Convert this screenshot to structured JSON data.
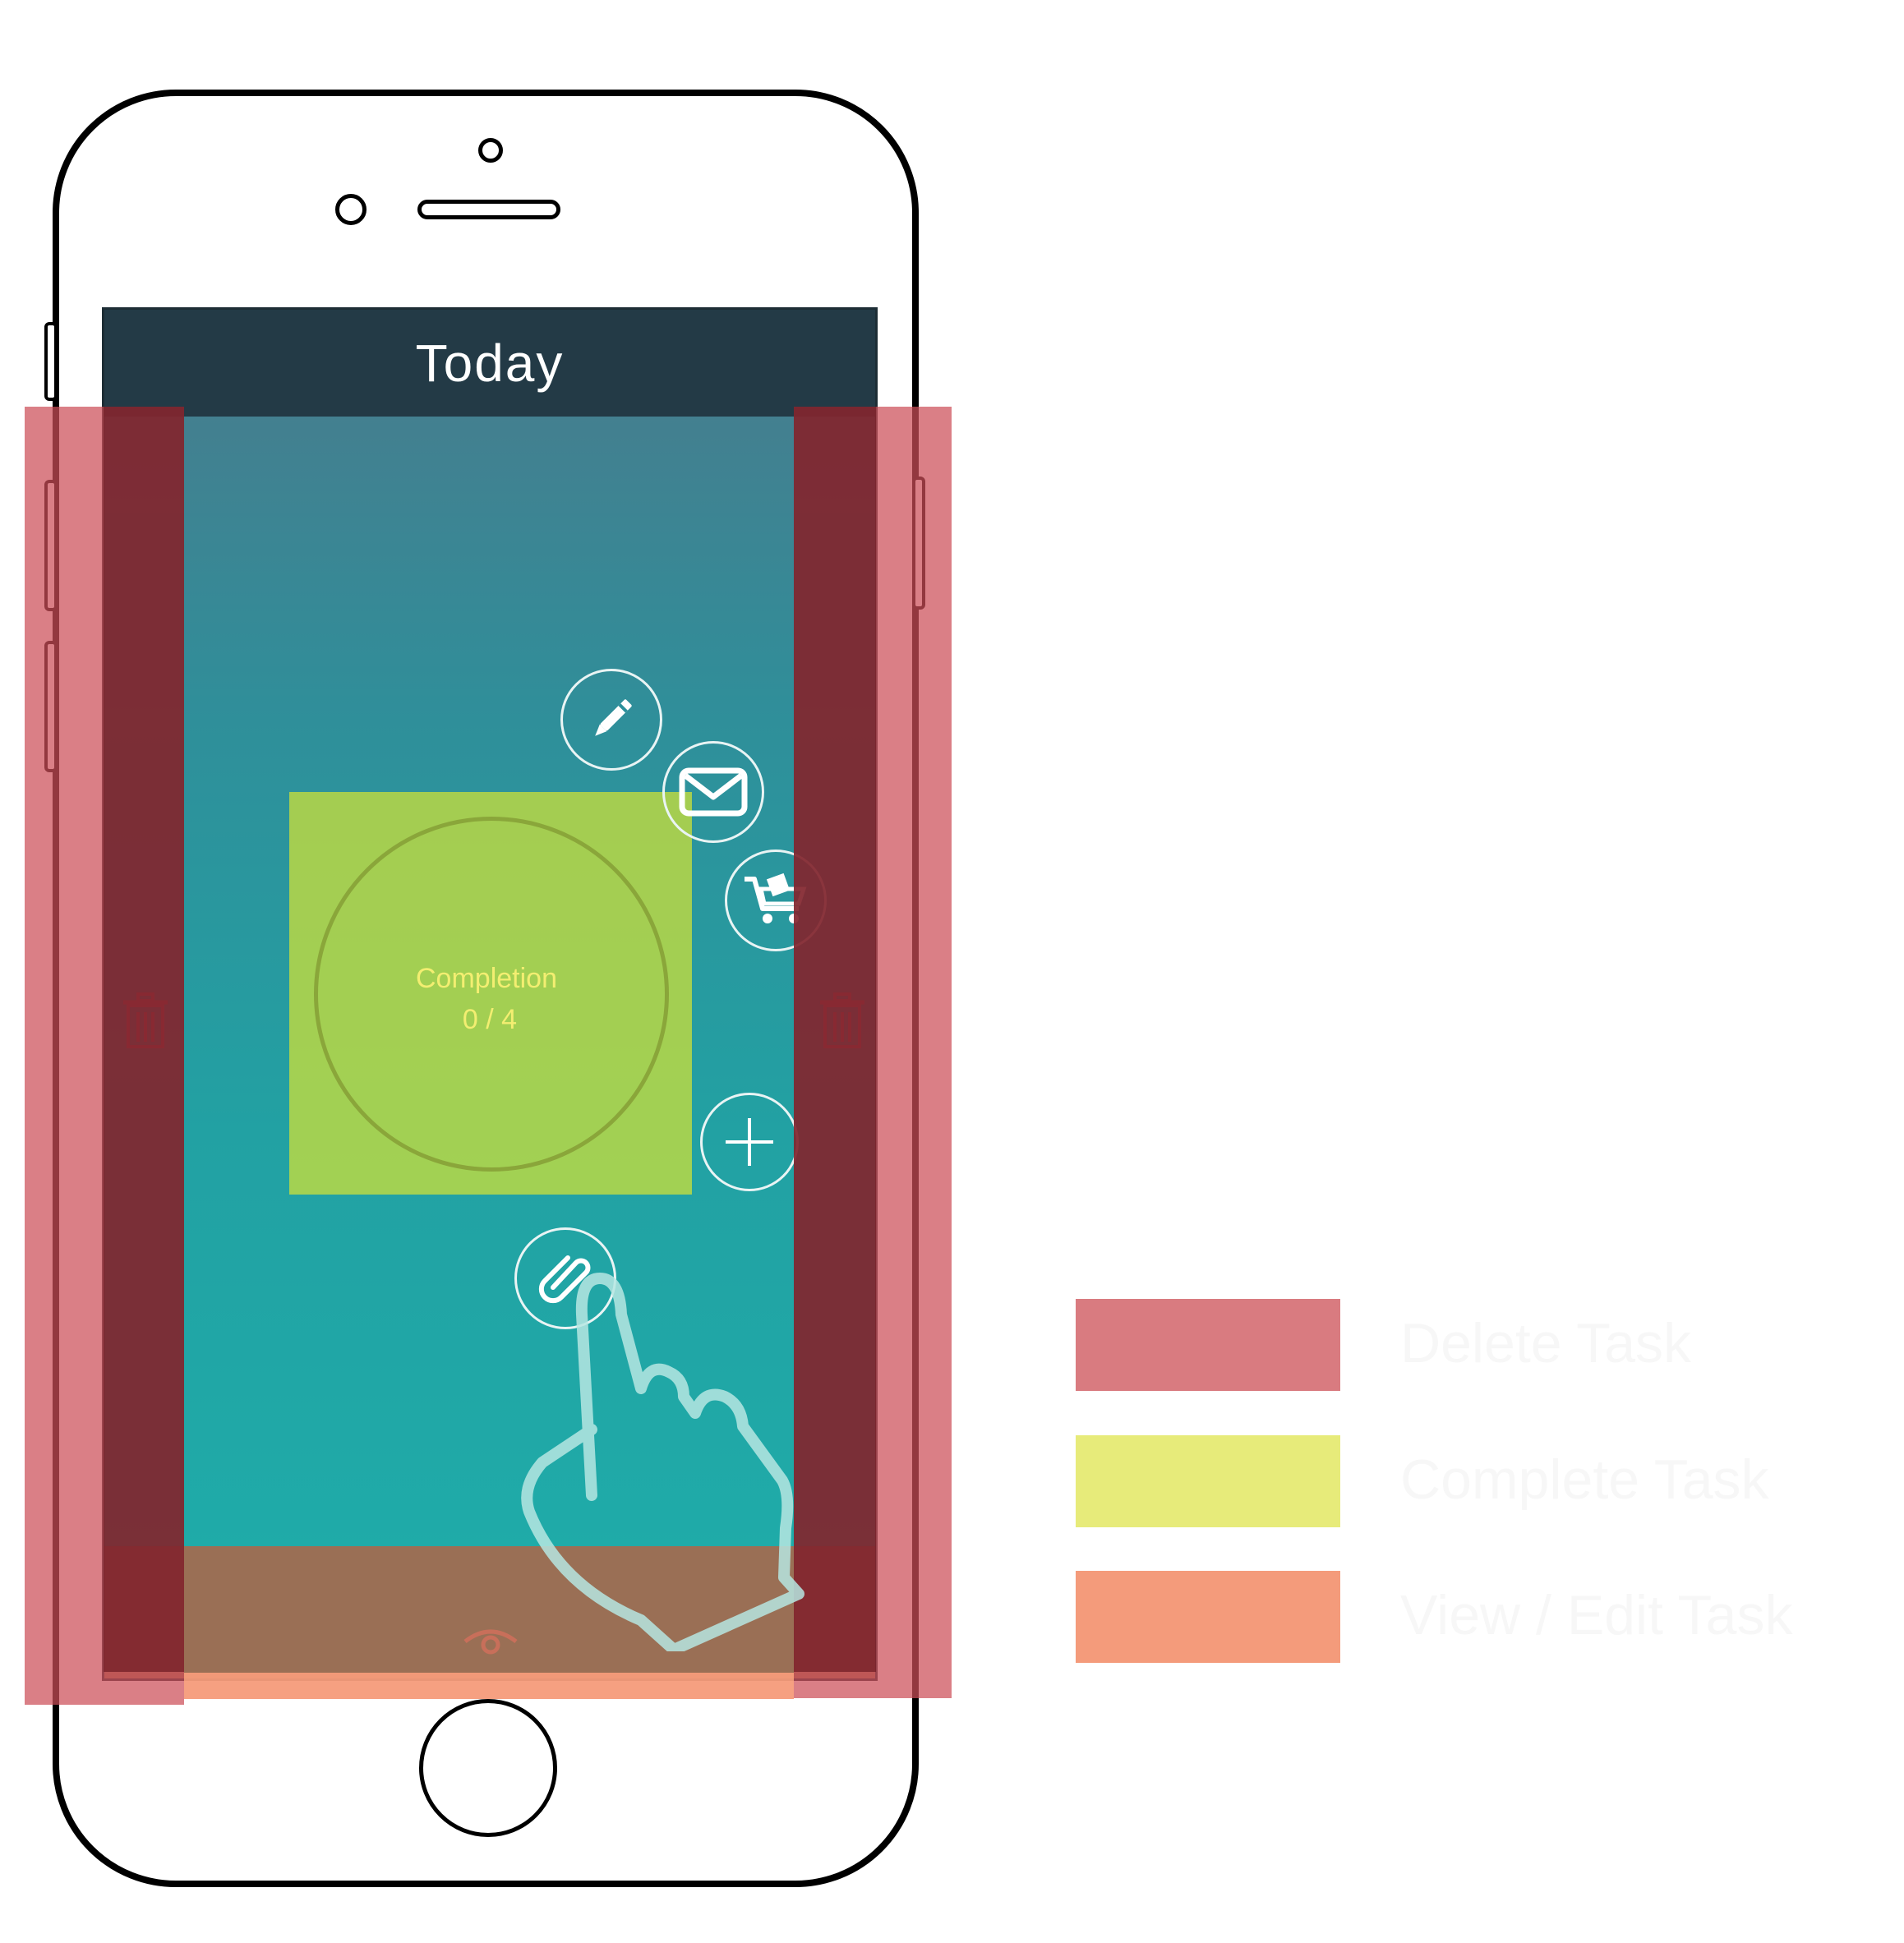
{
  "screen": {
    "title": "Today",
    "completion_label": "Completion",
    "completion_count": "0 / 4"
  },
  "actions": [
    {
      "name": "edit",
      "icon": "pen-icon"
    },
    {
      "name": "email",
      "icon": "envelope-icon"
    },
    {
      "name": "cart",
      "icon": "cart-icon"
    },
    {
      "name": "add",
      "icon": "plus-icon"
    },
    {
      "name": "attach",
      "icon": "paperclip-icon"
    }
  ],
  "legend": [
    {
      "label": "Delete Task",
      "color": "#d97b80"
    },
    {
      "label": "Complete Task",
      "color": "#e7eb7a"
    },
    {
      "label": "View / Edit Task",
      "color": "#f49b7b"
    }
  ],
  "colors": {
    "navbar": "#233a46",
    "delete": "#cc4e58",
    "complete": "#c6de3c",
    "view": "#f59b7a"
  }
}
